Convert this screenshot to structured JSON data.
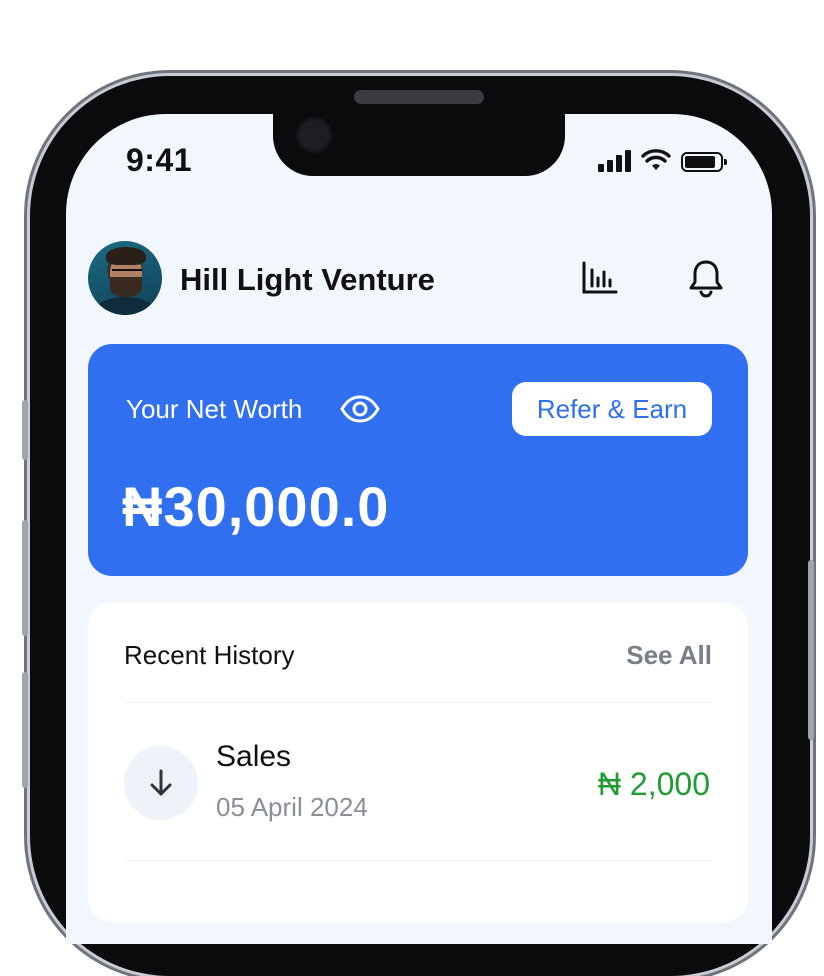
{
  "status_bar": {
    "time": "9:41"
  },
  "header": {
    "business_name": "Hill Light Venture"
  },
  "net_worth": {
    "label": "Your Net Worth",
    "refer_label": "Refer & Earn",
    "amount": "₦30,000.0"
  },
  "history": {
    "title": "Recent History",
    "see_all": "See All",
    "items": [
      {
        "name": "Sales",
        "date": "05 April 2024",
        "amount": "₦ 2,000"
      }
    ]
  },
  "colors": {
    "primary": "#2f6ff0",
    "positive": "#1f9d33",
    "background": "#f2f6fd"
  },
  "icons": [
    "avatar",
    "chart-icon",
    "bell-icon",
    "eye-icon",
    "arrow-down-icon",
    "signal-icon",
    "wifi-icon",
    "battery-icon"
  ]
}
